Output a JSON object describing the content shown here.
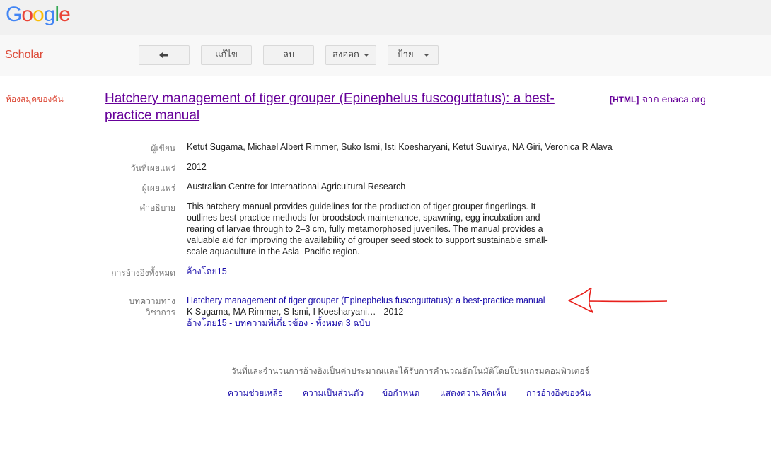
{
  "logo": {
    "letters": [
      "G",
      "o",
      "o",
      "g",
      "l",
      "e"
    ],
    "colors": [
      "#4285F4",
      "#EA4335",
      "#FBBC05",
      "#4285F4",
      "#34A853",
      "#EA4335"
    ]
  },
  "toolbar": {
    "product": "Scholar",
    "back_icon": "back-arrow-icon",
    "edit": "แก้ไข",
    "delete": "ลบ",
    "export": "ส่งออก",
    "label": "ป้าย"
  },
  "nav": {
    "my_library": "ห้องสมุดของฉัน"
  },
  "article": {
    "title": "Hatchery management of tiger grouper (Epinephelus fuscoguttatus): a best-practice manual",
    "source_format": "[HTML]",
    "source_text": " จาก enaca.org"
  },
  "fields": {
    "authors_label": "ผู้เขียน",
    "authors": "Ketut Sugama, Michael Albert Rimmer, Suko Ismi, Isti Koesharyani, Ketut Suwirya, NA Giri, Veronica R Alava",
    "date_label": "วันที่เผยแพร่",
    "date": "2012",
    "publisher_label": "ผู้เผยแพร่",
    "publisher": "Australian Centre for International Agricultural Research",
    "description_label": "คำอธิบาย",
    "description": "This hatchery manual provides guidelines for the production of tiger grouper fingerlings. It outlines best-practice methods for broodstock maintenance, spawning, egg incubation and rearing of larvae through to 2–3 cm, fully metamorphosed juveniles. The manual provides a valuable aid for improving the availability of grouper seed stock to support sustainable small-scale aquaculture in the Asia–Pacific region.",
    "citations_label": "การอ้างอิงทั้งหมด",
    "citations": "อ้างโดย15",
    "scholar_label_1": "บทความทาง",
    "scholar_label_2": "วิชาการ",
    "scholar_title": "Hatchery management of tiger grouper (Epinephelus fuscoguttatus): a best-practice manual",
    "scholar_authors": "K Sugama, MA Rimmer, S Ismi, I Koesharyani… - 2012",
    "scholar_cited": "อ้างโดย15",
    "scholar_sep1": " - ",
    "scholar_related": "บทความที่เกี่ยวข้อง",
    "scholar_sep2": " - ",
    "scholar_versions": "ทั้งหมด 3 ฉบับ"
  },
  "footer": {
    "note": "วันที่และจำนวนการอ้างอิงเป็นค่าประมาณและได้รับการคำนวณอัตโนมัติโดยโปรแกรมคอมพิวเตอร์",
    "links": [
      "ความช่วยเหลือ",
      "ความเป็นส่วนตัว",
      "ข้อกำหนด",
      "แสดงความคิดเห็น",
      "การอ้างอิงของฉัน"
    ]
  },
  "annotation": {
    "icon": "red-hand-drawn-arrow-icon",
    "color": "#e8201c"
  }
}
